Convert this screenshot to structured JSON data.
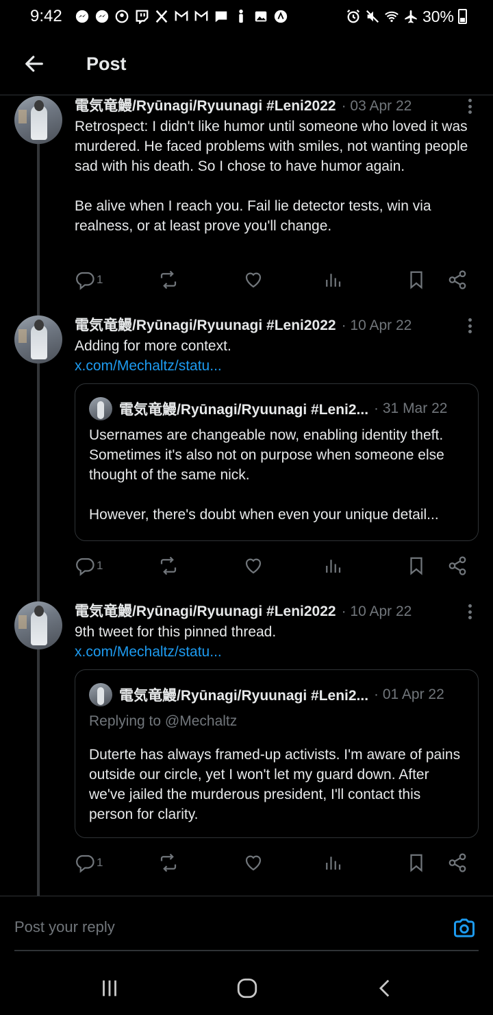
{
  "status_bar": {
    "time": "9:42",
    "battery": "30%",
    "icons": [
      "messenger-icon",
      "messenger-icon",
      "account-icon",
      "twitch-icon",
      "x-icon",
      "gmail-icon",
      "gmail-icon",
      "chat-icon",
      "figure-icon",
      "gallery-icon",
      "vpn-icon",
      "alarm-icon",
      "mute-icon",
      "wifi-icon",
      "airplane-icon",
      "battery-icon"
    ]
  },
  "header": {
    "title": "Post",
    "back_icon": "arrow-left-icon"
  },
  "tweets": [
    {
      "name": "電気竜鰻/Ryūnagi/Ryuunagi #Leni2022",
      "date": "· 03 Apr 22",
      "text": "Retrospect: I didn't like humor until someone who loved it was murdered. He faced problems with smiles, not wanting people sad with his death. So I chose to have humor again.\n\nBe alive when I reach you. Fail lie detector tests, win via realness, or at least prove you'll change.",
      "replies": "1"
    },
    {
      "name": "電気竜鰻/Ryūnagi/Ryuunagi #Leni2022",
      "date": "· 10 Apr 22",
      "text": "Adding for more context.",
      "link": "x.com/Mechaltz/statu...",
      "quote": {
        "name": "電気竜鰻/Ryūnagi/Ryuunagi #Leni2...",
        "date": "· 31 Mar 22",
        "text": "Usernames are changeable now, enabling identity theft. Sometimes it's also not on purpose when someone else thought of the same nick.\n\nHowever, there's doubt when even your unique detail..."
      },
      "replies": "1"
    },
    {
      "name": "電気竜鰻/Ryūnagi/Ryuunagi #Leni2022",
      "date": "· 10 Apr 22",
      "text": "9th tweet for this pinned thread.",
      "link": "x.com/Mechaltz/statu...",
      "quote": {
        "name": "電気竜鰻/Ryūnagi/Ryuunagi #Leni2...",
        "date": "· 01 Apr 22",
        "reply_to": "Replying to @Mechaltz",
        "text": "Duterte has always framed-up activists. I'm aware of pains outside our circle, yet I won't let my guard down. After we've jailed the murderous president, I'll contact this person for clarity."
      },
      "replies": "1"
    }
  ],
  "reply_bar": {
    "placeholder": "Post your reply",
    "camera_icon": "camera-icon"
  },
  "nav_bar": {
    "icons": [
      "recents-icon",
      "home-icon",
      "back-icon"
    ]
  },
  "colors": {
    "background": "#000000",
    "text": "#e7e9ea",
    "muted": "#71767b",
    "link": "#1d9bf0",
    "divider": "#2f3336"
  }
}
